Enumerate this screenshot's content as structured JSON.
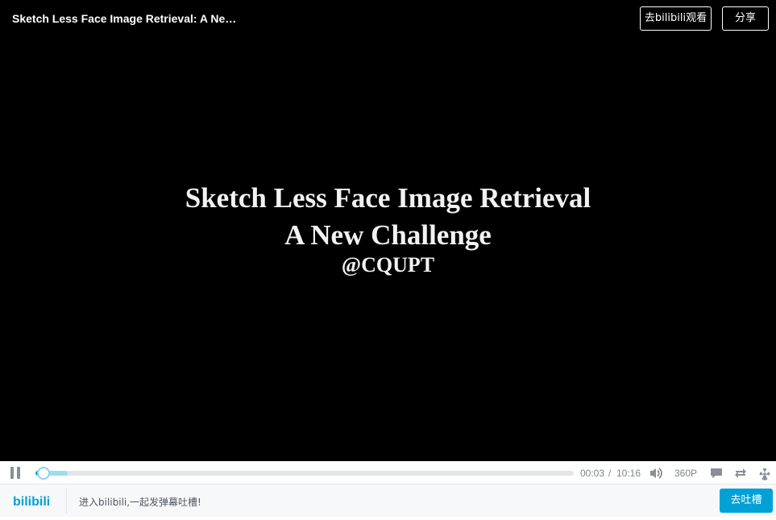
{
  "header": {
    "video_title": "Sketch Less Face Image Retrieval: A Ne…",
    "watch_on_bilibili_label": "去bilibili观看",
    "share_label": "分享"
  },
  "video_frame": {
    "line1": "Sketch Less Face Image Retrieval",
    "line2": "A New Challenge",
    "line3": "@CQUPT"
  },
  "controls": {
    "current_time": "00:03",
    "time_separator": "/",
    "total_time": "10:16",
    "quality": "360P",
    "played_fraction": 0.015,
    "buffered_fraction": 0.06,
    "icons": [
      "pause-icon",
      "volume-icon",
      "danmaku-icon",
      "loop-icon",
      "radiation-icon"
    ]
  },
  "footer": {
    "logo_text": "bilibili",
    "danmaku_prompt": "进入bilibili,一起发弹幕吐槽!",
    "go_comment_label": "去吐槽"
  },
  "colors": {
    "accent": "#00a1d6",
    "buffer": "#9fdcef",
    "icon_gray": "#8a8f96"
  }
}
